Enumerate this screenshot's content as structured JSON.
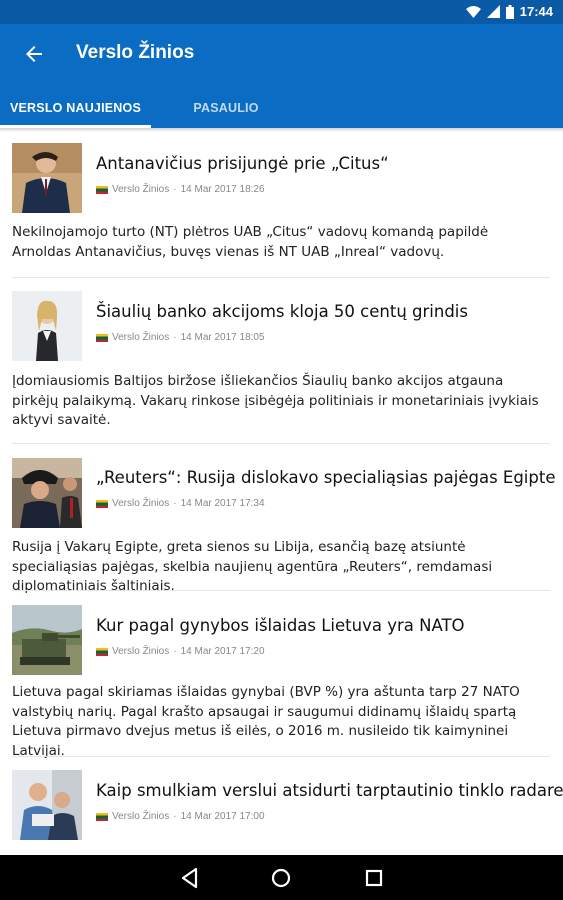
{
  "status_bar": {
    "time": "17:44",
    "icons": [
      "wifi-icon",
      "signal-icon",
      "battery-icon"
    ]
  },
  "app_bar": {
    "title": "Verslo Žinios",
    "back_icon": "arrow-back-icon"
  },
  "tabs": [
    {
      "label": "VERSLO NAUJIENOS",
      "active": true
    },
    {
      "label": "PASAULIO",
      "active": false
    }
  ],
  "articles": [
    {
      "title": "Antanavičius prisijungė prie „Citus“",
      "source": "Verslo Žinios",
      "date": "14 Mar 2017 18:26",
      "summary": "Nekilnojamojo turto (NT) plėtros UAB „Citus“ vadovų komandą papildė Arnoldas Antanavičius, buvęs vienas iš NT UAB „Inreal“ vadovų."
    },
    {
      "title": "Šiaulių banko akcijoms kloja 50 centų grindis",
      "source": "Verslo Žinios",
      "date": "14 Mar 2017 18:05",
      "summary": "Įdomiausiomis Baltijos biržose išliekančios Šiaulių banko akcijos atgauna pirkėjų palaikymą. Vakarų rinkose įsibėgėja politiniais ir monetariniais įvykiais aktyvi savaitė."
    },
    {
      "title": "„Reuters“: Rusija dislokavo specialiąsias pajėgas Egipte",
      "source": "Verslo Žinios",
      "date": "14 Mar 2017 17:34",
      "summary": "Rusija į Vakarų Egipte, greta sienos su Libija, esančią bazę atsiuntė specialiąsias pajėgas, skelbia naujienų agentūra „Reuters“, remdamasi diplomatiniais šaltiniais."
    },
    {
      "title": "Kur pagal gynybos išlaidas Lietuva yra NATO",
      "source": "Verslo Žinios",
      "date": "14 Mar 2017 17:20",
      "summary": "Lietuva pagal skiriamas išlaidas gynybai (BVP %) yra aštunta tarp 27 NATO valstybių narių. Pagal krašto apsaugai ir saugumui didinamų išlaidų spartą Lietuva pirmavo dvejus metus iš eilės, o 2016 m. nusileido tik kaimyninei Latvijai."
    },
    {
      "title": "Kaip smulkiam verslui atsidurti tarptautinio tinklo radare",
      "source": "Verslo Žinios",
      "date": "14 Mar 2017 17:00",
      "summary": ""
    }
  ],
  "nav_bar": {
    "icons": [
      "back-triangle-icon",
      "home-circle-icon",
      "recents-square-icon"
    ]
  },
  "colors": {
    "status_bar": "#0b5aa6",
    "app_bar": "#0b6cc4",
    "nav_bar": "#000000"
  }
}
